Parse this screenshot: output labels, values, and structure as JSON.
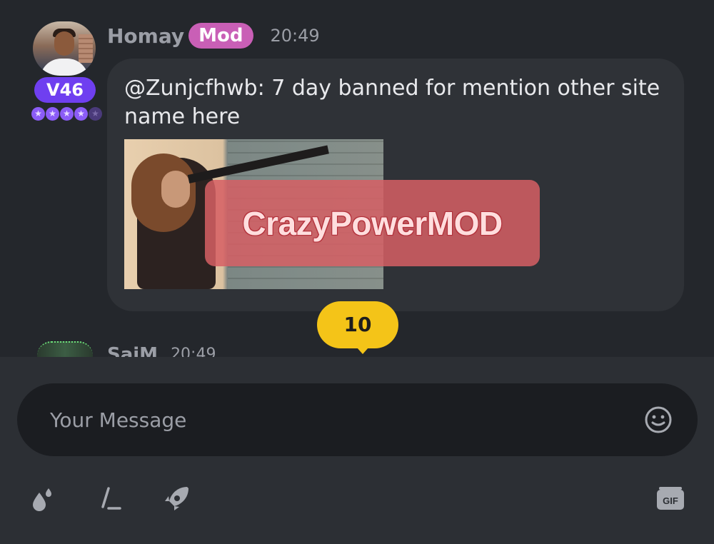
{
  "message": {
    "username": "Homay",
    "role_badge": "Mod",
    "time": "20:49",
    "vip_level": "V46",
    "stars_filled": 4,
    "stars_total": 5,
    "text": "@Zunjcfhwb: 7 day banned for mention other site name here",
    "image_watermark": "CrazyPowerMOD"
  },
  "unread_count": "10",
  "next_message": {
    "username": "SaiM",
    "time": "20:49"
  },
  "composer": {
    "placeholder": "Your Message",
    "value": "",
    "tools": [
      "drops-icon",
      "slash-command-icon",
      "rocket-icon"
    ],
    "gif_label": "GIF"
  },
  "colors": {
    "background": "#24272c",
    "bubble": "#2f3237",
    "mod_badge": "#c95fb6",
    "vip_badge": "#6f3ff0",
    "unread_badge": "#f4c418"
  }
}
